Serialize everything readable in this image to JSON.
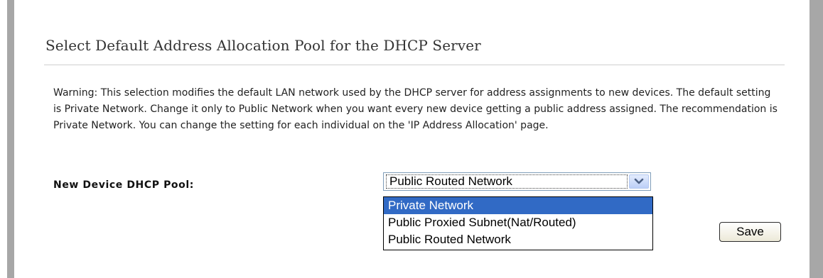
{
  "section": {
    "title": "Select Default Address Allocation Pool for the DHCP Server"
  },
  "warning": {
    "text": "Warning: This selection modifies the default LAN network used by the DHCP server for address assignments to new devices. The default setting is Private Network. Change it only to Public Network when you want every new device getting a public address assigned. The recommendation is Private Network. You can change the setting for each individual on the 'IP Address Allocation' page."
  },
  "dhcp_pool": {
    "label": "New Device DHCP Pool:",
    "selected_value": "Public Routed Network",
    "options": [
      "Private Network",
      "Public Proxied Subnet(Nat/Routed)",
      "Public Routed Network"
    ],
    "highlighted_option": "Private Network"
  },
  "save": {
    "label": "Save"
  },
  "colors": {
    "frame": "#a7a7a7",
    "highlight": "#316ac5",
    "rule": "#cfcfcf"
  },
  "icons": {
    "dropdown": "chevron-down-icon"
  }
}
